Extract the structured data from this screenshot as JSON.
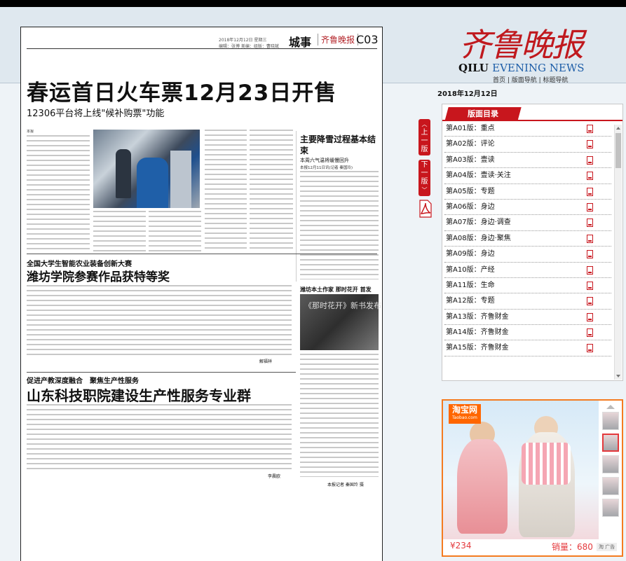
{
  "newspaper": {
    "header": {
      "meta_line1": "2018年12月12日 星期三",
      "meta_line2": "编辑：张博 美编：组版：曹晓斌",
      "section": "城事",
      "logo": "齐鲁晚报",
      "page": "C03"
    },
    "headline": "春运首日火车票12月23日开售",
    "subheadline": "12306平台将上线\"候补购票\"功能",
    "lead": "本报12月11日讯 记者 王琳",
    "side": {
      "title": "主要降雪过程基本结束",
      "subtitle": "本周六气温将缓慢回升",
      "byline": "本报12月11日讯(记者 秦国玲)"
    },
    "story2": {
      "kicker": "全国大学生智能农业装备创新大赛",
      "title": "潍坊学院参赛作品获特等奖",
      "signature": "解福祥"
    },
    "story3": {
      "side_title": "潍坊本土作家 那时花开 首发",
      "photo_caption": "《那时花开》新书发布",
      "kicker": "促进产教深度融合　聚焦生产性服务",
      "title": "山东科技职院建设生产性服务专业群",
      "signature": "李晨欧",
      "reporter": "本报记者 秦国玲 摄"
    }
  },
  "brand": {
    "name_cn": "齐鲁晚报",
    "name_en_part1": "QILU",
    "name_en_part2": "EVENING NEWS",
    "nav": "首页 | 版面导航 | 标题导航"
  },
  "date": "2018年12月12日",
  "nav_buttons": {
    "prev": "上一版",
    "next": "下一版"
  },
  "page_list": {
    "heading": "版面目录",
    "items": [
      {
        "label": "第A01版：重点"
      },
      {
        "label": "第A02版：评论"
      },
      {
        "label": "第A03版：壹读"
      },
      {
        "label": "第A04版：壹读·关注"
      },
      {
        "label": "第A05版：专题"
      },
      {
        "label": "第A06版：身边"
      },
      {
        "label": "第A07版：身边·调查"
      },
      {
        "label": "第A08版：身边·聚焦"
      },
      {
        "label": "第A09版：身边"
      },
      {
        "label": "第A10版：产经"
      },
      {
        "label": "第A11版：生命"
      },
      {
        "label": "第A12版：专题"
      },
      {
        "label": "第A13版：齐鲁财金"
      },
      {
        "label": "第A14版：齐鲁财金"
      },
      {
        "label": "第A15版：齐鲁财金"
      }
    ]
  },
  "ad": {
    "logo": "淘宝网",
    "logo_sub": "Taobao.com",
    "price": "¥234",
    "sales": "销量：680",
    "tag": "淘 广告"
  }
}
